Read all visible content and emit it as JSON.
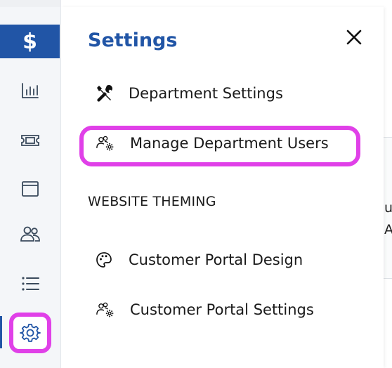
{
  "rail": {
    "brand_symbol": "$",
    "items": [
      {
        "icon": "bar-chart-icon"
      },
      {
        "icon": "ticket-icon"
      },
      {
        "icon": "browser-window-icon"
      },
      {
        "icon": "users-icon"
      },
      {
        "icon": "list-icon"
      },
      {
        "icon": "gear-icon",
        "active": true
      }
    ]
  },
  "panel": {
    "title": "Settings",
    "close_icon": "close-icon",
    "items": [
      {
        "label": "Department Settings",
        "icon": "tools-icon"
      },
      {
        "label": "Manage Department Users",
        "icon": "users-gear-icon",
        "highlighted": true
      }
    ],
    "section": {
      "label": "WEBSITE THEMING",
      "items": [
        {
          "label": "Customer Portal Design",
          "icon": "palette-icon"
        },
        {
          "label": "Customer Portal Settings",
          "icon": "users-gear-icon"
        }
      ]
    }
  },
  "background": {
    "fragment_1": "u",
    "fragment_2": "A"
  },
  "colors": {
    "accent": "#2155a6",
    "highlight": "#e040e8",
    "rail_bg": "#f4f6f9"
  }
}
